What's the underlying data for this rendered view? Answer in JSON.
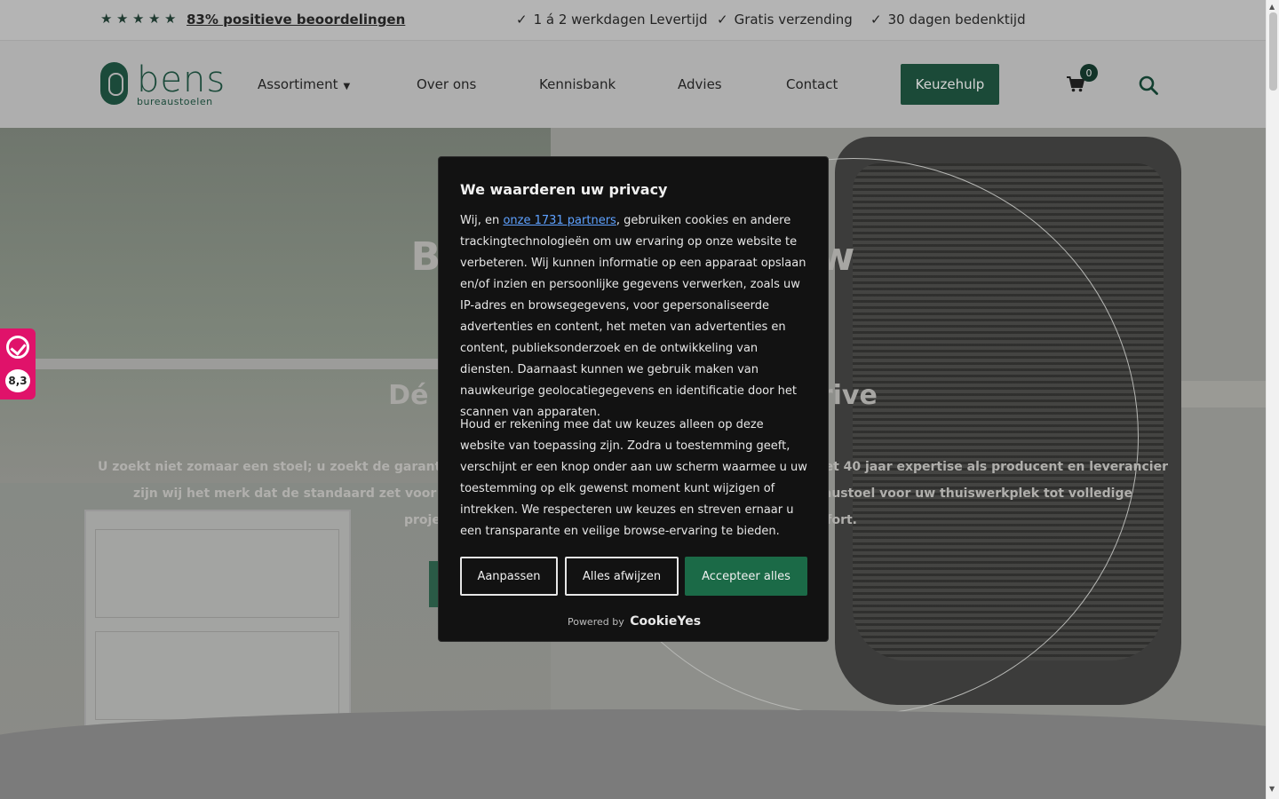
{
  "topbar": {
    "reviews": "83% positieve beoordelingen",
    "usps": [
      "1 á 2 werkdagen Levertijd",
      "Gratis verzending",
      "30 dagen bedenktijd"
    ]
  },
  "header": {
    "logo_word": "bens",
    "logo_sub": "bureaustoelen",
    "nav": [
      "Assortiment",
      "Over ons",
      "Kennisbank",
      "Advies",
      "Contact"
    ],
    "cta": "Keuzehulp",
    "cart_count": "0"
  },
  "hero": {
    "title_left": "Be",
    "title_right": "Uw",
    "sub_left": "Dé k",
    "sub_right": "rive",
    "text_line1_left": "U zoekt niet zomaar een stoel; u zoekt de garantie op ee",
    "text_line1_right": "oron. Met 40 jaar expertise als producent en leverancier",
    "text_line2_left": "zijn wij het merk dat de standaard zet voor ergonc",
    "text_line2_right": "e bureaustoel voor uw thuiswerkplek tot volledige",
    "text_line3_left": "projec",
    "text_line3_right": "nfort."
  },
  "kiyoh": {
    "score": "8,3"
  },
  "cookie": {
    "title": "We waarderen uw privacy",
    "p1_before": "Wij, en ",
    "p1_link": "onze 1731 partners",
    "p1_after": ", gebruiken cookies en andere trackingtechnologieën om uw ervaring op onze website te verbeteren. Wij kunnen informatie op een apparaat opslaan en/of inzien en persoonlijke gegevens verwerken, zoals uw IP-adres en browsegegevens, voor gepersonaliseerde advertenties en content, het meten van advertenties en content, publieksonderzoek en de ontwikkeling van diensten. Daarnaast kunnen we gebruik maken van nauwkeurige geolocatiegegevens en identificatie door het scannen van apparaten.",
    "p2": "Houd er rekening mee dat uw keuzes alleen op deze website van toepassing zijn. Zodra u toestemming geeft, verschijnt er een knop onder aan uw scherm waarmee u uw toestemming op elk gewenst moment kunt wijzigen of intrekken. We respecteren uw keuzes en streven ernaar u een transparante en veilige browse-ervaring te bieden.",
    "btn_customize": "Aanpassen",
    "btn_reject": "Alles afwijzen",
    "btn_accept": "Accepteer alles",
    "powered_by": "Powered by",
    "brand": "CookieYes"
  },
  "colors": {
    "brand_green": "#1b4a38",
    "accept_green": "#1b6a47",
    "link_blue": "#5ea1ff",
    "kiyoh_pink": "#e0126a"
  }
}
